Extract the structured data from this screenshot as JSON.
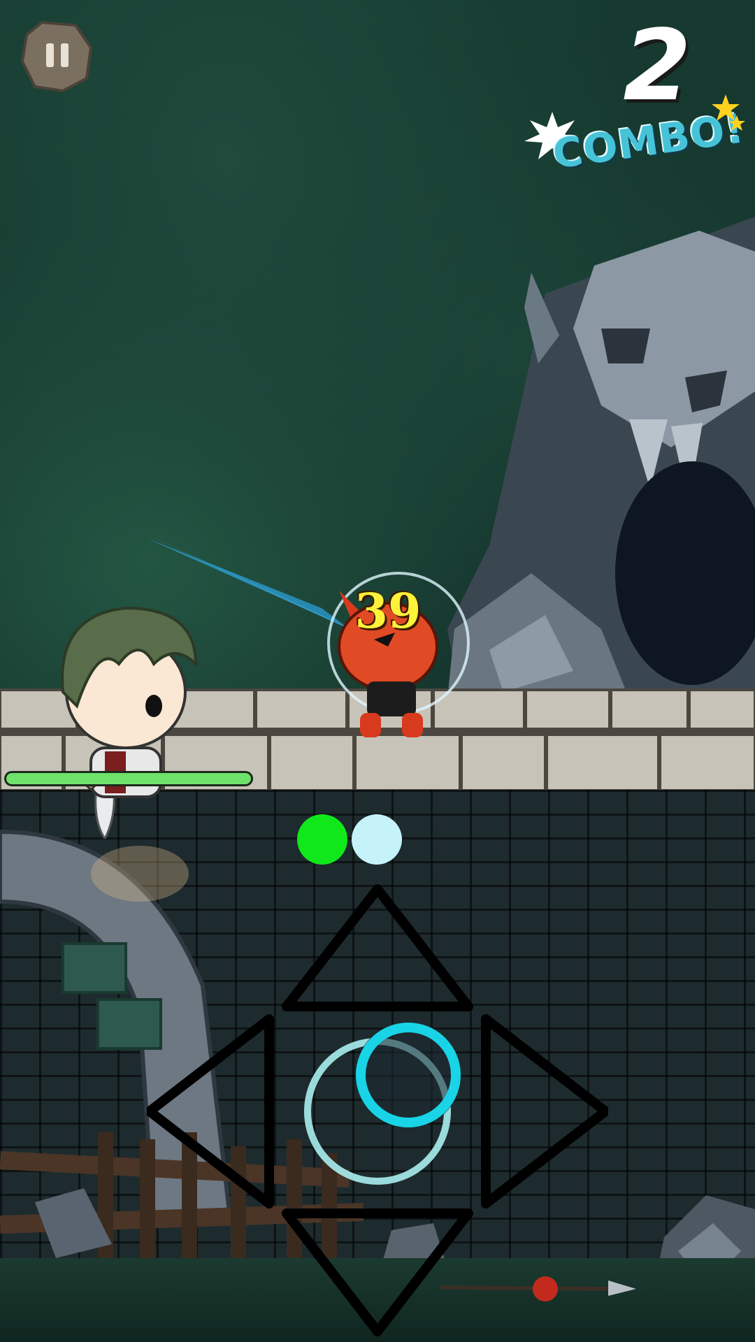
{
  "hud": {
    "pause": {
      "icon": "pause-icon"
    },
    "combo": {
      "count": "2",
      "label": "COMBO!"
    },
    "damage_popup": "39",
    "player_health_fraction": 1.0,
    "charge_indicators": [
      {
        "color": "#11e81b"
      },
      {
        "color": "#c6f3f9"
      }
    ]
  },
  "controls": {
    "dpad": {
      "up_icon": "triangle-up-icon",
      "down_icon": "triangle-down-icon",
      "left_icon": "triangle-left-icon",
      "right_icon": "triangle-right-icon"
    },
    "joystick": {
      "ring_color": "#18d4e6",
      "base_color": "#a9eef0"
    }
  },
  "colors": {
    "combo_label": "#47c3d8",
    "damage_text": "#fff23a",
    "health_fill": "#6ee26b"
  }
}
